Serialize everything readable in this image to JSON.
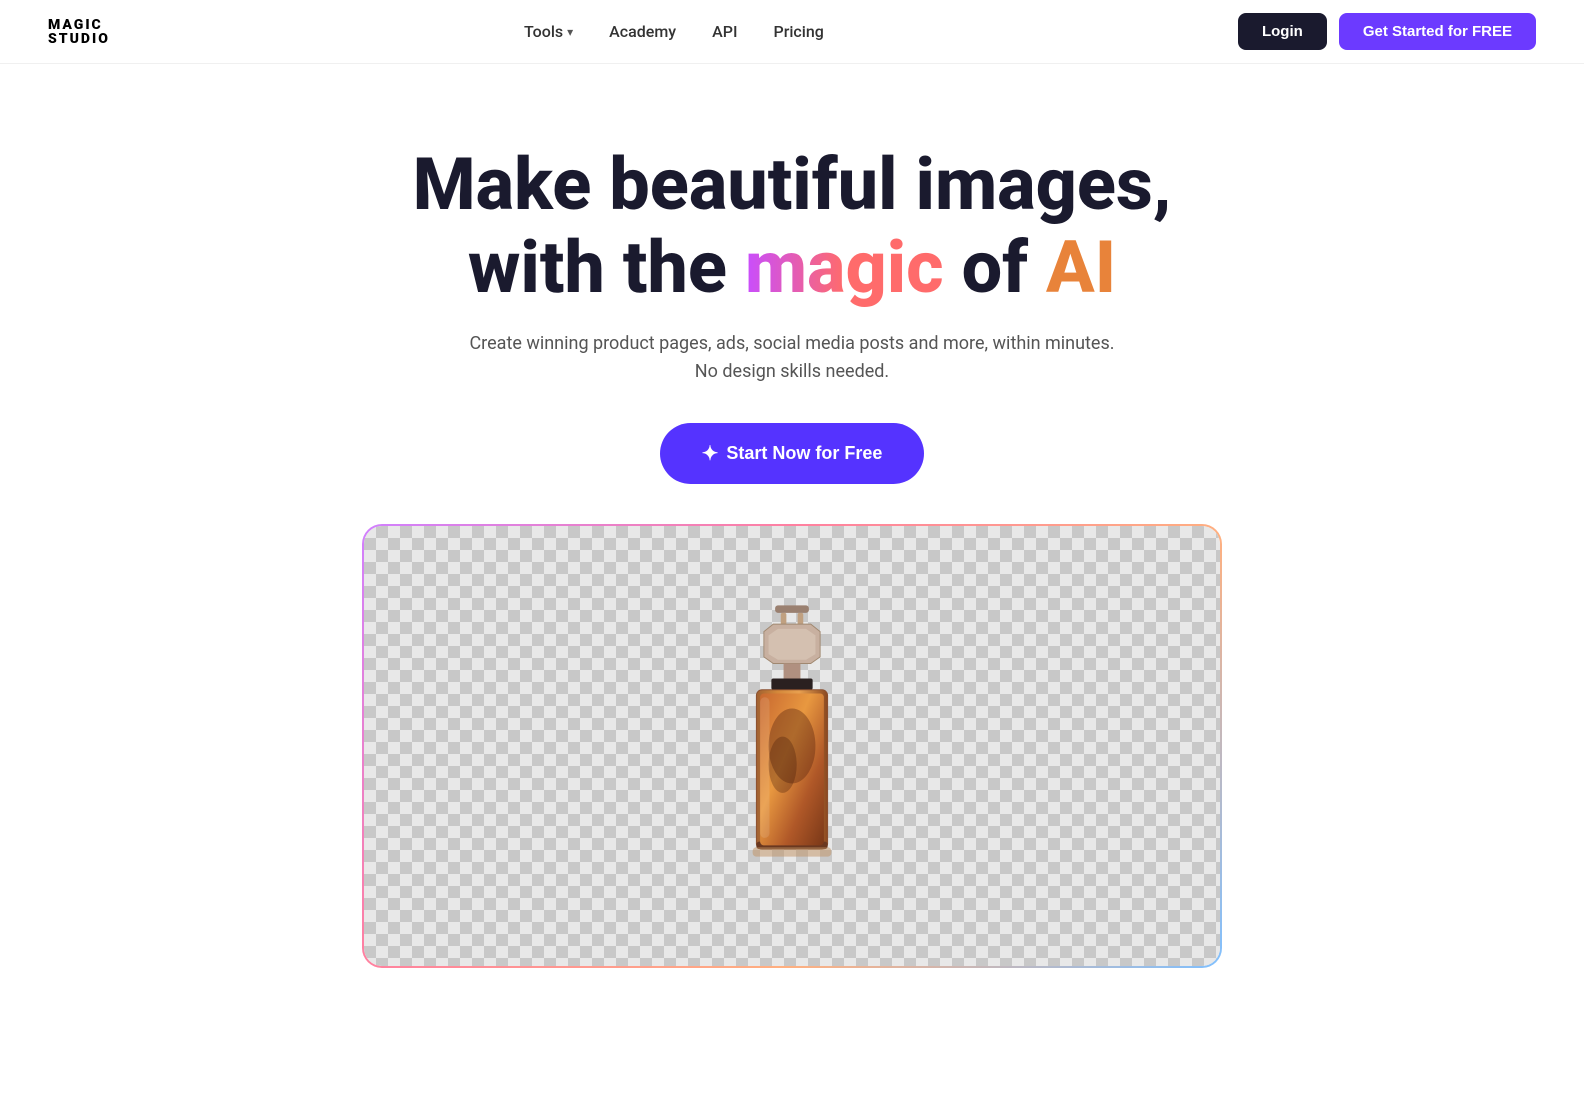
{
  "navbar": {
    "logo_line1": "MAGIC",
    "logo_line2": "STUDIO",
    "nav_items": [
      {
        "label": "Tools",
        "has_dropdown": true
      },
      {
        "label": "Academy",
        "has_dropdown": false
      },
      {
        "label": "API",
        "has_dropdown": false
      },
      {
        "label": "Pricing",
        "has_dropdown": false
      }
    ],
    "login_label": "Login",
    "get_started_label": "Get Started for FREE"
  },
  "hero": {
    "title_line1": "Make beautiful images,",
    "title_line2_start": "with the ",
    "title_magic": "magic",
    "title_of": " of ",
    "title_ai": "AI",
    "subtitle_line1": "Create winning product pages, ads, social media posts and more, within minutes.",
    "subtitle_line2": "No design skills needed.",
    "cta_label": "Start Now for Free",
    "sparkle": "✦"
  }
}
